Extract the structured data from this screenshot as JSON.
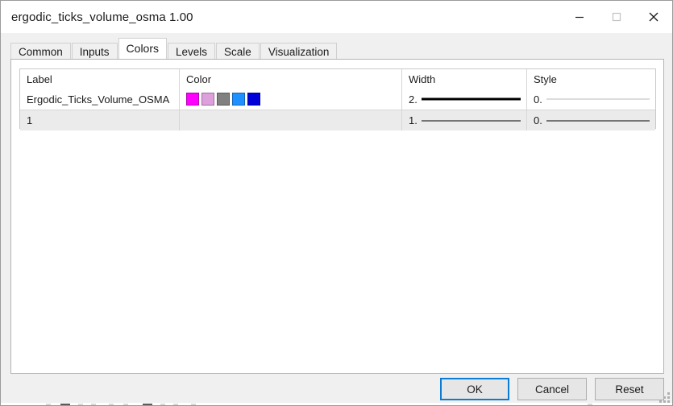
{
  "window": {
    "title": "ergodic_ticks_volume_osma 1.00",
    "controls": [
      {
        "name": "minimize",
        "glyph": "minimize-icon"
      },
      {
        "name": "maximize",
        "glyph": "maximize-icon"
      },
      {
        "name": "close",
        "glyph": "close-icon"
      }
    ]
  },
  "tabs": [
    {
      "label": "Common",
      "selected": false
    },
    {
      "label": "Inputs",
      "selected": false
    },
    {
      "label": "Colors",
      "selected": true
    },
    {
      "label": "Levels",
      "selected": false
    },
    {
      "label": "Scale",
      "selected": false
    },
    {
      "label": "Visualization",
      "selected": false
    }
  ],
  "table": {
    "headers": {
      "label": "Label",
      "color": "Color",
      "width": "Width",
      "style": "Style"
    },
    "rows": [
      {
        "label": "Ergodic_Ticks_Volume_OSMA",
        "colors": [
          "#FF00FF",
          "#DDA0DD",
          "#808080",
          "#1E90FF",
          "#0000D8"
        ],
        "width_value": "2.",
        "width_preview": "thick-solid-line",
        "style_value": "0.",
        "style_preview": "thin-gray-solid-line"
      },
      {
        "label": "1",
        "colors": [],
        "width_value": "1.",
        "width_preview": "thin-black-solid-line",
        "style_value": "0.",
        "style_preview": "thin-black-solid-line"
      }
    ]
  },
  "footer": {
    "buttons": [
      {
        "label": "OK",
        "default": true
      },
      {
        "label": "Cancel",
        "default": false
      },
      {
        "label": "Reset",
        "default": false
      }
    ]
  },
  "colors": {
    "accent": "#0a7cd6",
    "window_bg": "#f0f0f0",
    "panel_bg": "#ffffff",
    "alt_row_bg": "#ebebeb"
  }
}
